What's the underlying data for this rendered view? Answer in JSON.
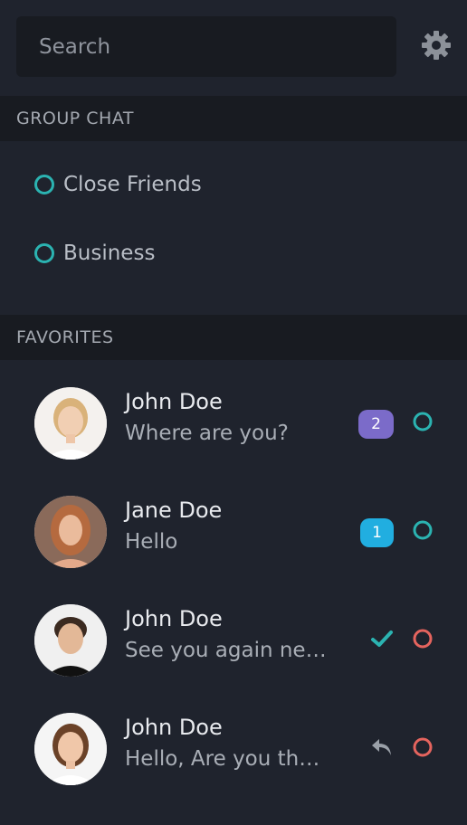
{
  "search": {
    "placeholder": "Search"
  },
  "group_chat": {
    "header": "GROUP CHAT",
    "items": [
      {
        "label": "Close Friends",
        "status_color": "#2bb3b1"
      },
      {
        "label": "Business",
        "status_color": "#2bb3b1"
      }
    ]
  },
  "favorites": {
    "header": "FAVORITES",
    "items": [
      {
        "name": "John Doe",
        "message": "Where are you?",
        "badge": "2",
        "badge_color": "#7b6bc9",
        "status": "online"
      },
      {
        "name": "Jane Doe",
        "message": "Hello",
        "badge": "1",
        "badge_color": "#21aee0",
        "status": "online"
      },
      {
        "name": "John Doe",
        "message": "See you again ne…",
        "indicator": "check-icon",
        "status": "offline"
      },
      {
        "name": "John Doe",
        "message": "Hello, Are you th…",
        "indicator": "reply-icon",
        "status": "offline"
      }
    ]
  },
  "colors": {
    "online": "#2bb3b1",
    "offline": "#e5645e",
    "background": "#1f232d",
    "header_bg": "#181b21"
  }
}
